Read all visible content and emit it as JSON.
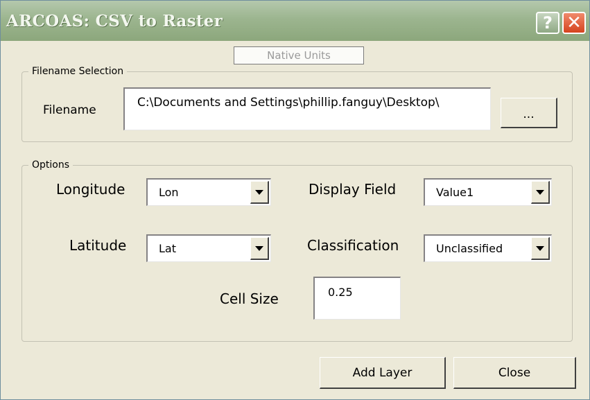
{
  "window": {
    "title": "ARCOAS:  CSV to Raster",
    "help_glyph": "?",
    "close_glyph": "✕"
  },
  "units": {
    "label": "Native Units"
  },
  "filename_group": {
    "legend": "Filename Selection",
    "label": "Filename",
    "value": "C:\\Documents and Settings\\phillip.fanguy\\Desktop\\",
    "browse_label": "..."
  },
  "options_group": {
    "legend": "Options",
    "longitude": {
      "label": "Longitude",
      "value": "Lon"
    },
    "latitude": {
      "label": "Latitude",
      "value": "Lat"
    },
    "display_field": {
      "label": "Display Field",
      "value": "Value1"
    },
    "classification": {
      "label": "Classification",
      "value": "Unclassified"
    },
    "cell_size": {
      "label": "Cell Size",
      "value": "0.25"
    }
  },
  "buttons": {
    "add_layer": "Add Layer",
    "close": "Close"
  },
  "colors": {
    "titlebar": "#9cb58f",
    "dialog_bg": "#ece9d8",
    "close_button": "#d5431e"
  }
}
